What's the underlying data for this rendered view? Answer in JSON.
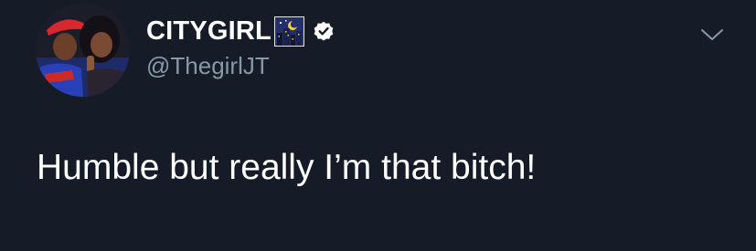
{
  "tweet": {
    "display_name": "CITYGIRL",
    "name_emoji": "night-with-stars-emoji",
    "verified_icon": "verified-badge-icon",
    "handle": "@ThegirlJT",
    "text": "Humble but really I’m that bitch!",
    "menu_icon": "chevron-down-icon"
  },
  "colors": {
    "background": "#151c28",
    "text_primary": "#ffffff",
    "text_secondary": "#8899a6",
    "verified_badge": "#ffffff"
  }
}
